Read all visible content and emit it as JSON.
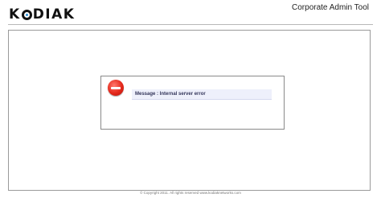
{
  "header": {
    "logo_text": {
      "before_o": "K",
      "after_o": "DIAK"
    },
    "app_title": "Corporate Admin Tool"
  },
  "dialog": {
    "icon": "error-stop-icon",
    "message": "Message : Internal server error"
  },
  "footer": {
    "copyright": "© Copyright 2011. All rights reserved www.kodiaknetworks.com"
  }
}
